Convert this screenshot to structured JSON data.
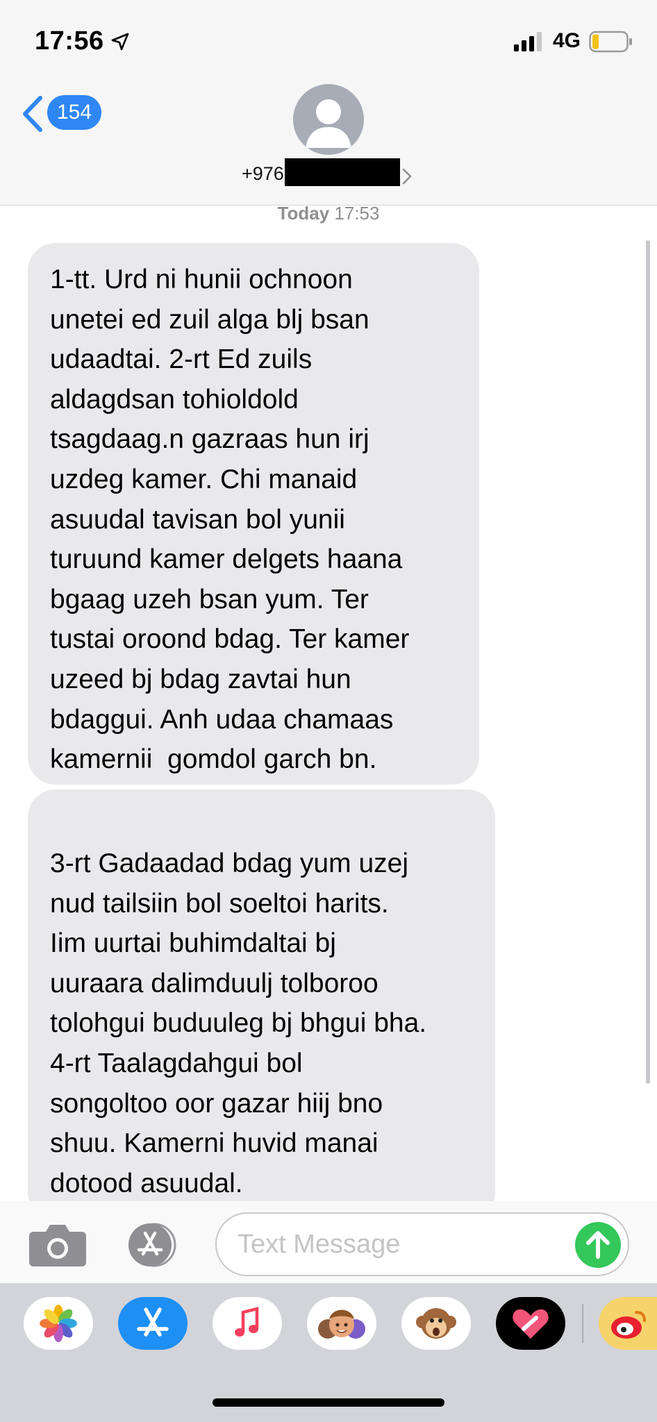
{
  "status_bar": {
    "time": "17:56",
    "network": "4G",
    "icons": [
      "location-arrow-icon",
      "signal-bars-icon",
      "battery-low-icon"
    ]
  },
  "header": {
    "back_count": "154",
    "contact_number_visible": "+976",
    "contact_number_redacted": true
  },
  "conversation": {
    "timestamp_day": "Today",
    "timestamp_time": "17:53",
    "messages": [
      {
        "direction": "incoming",
        "lines": [
          "1-tt. Urd ni hunii ochnoon",
          "unetei ed zuil alga blj bsan",
          "udaadtai. 2-rt Ed zuils",
          "aldagdsan tohioldold",
          "tsagdaag.n gazraas hun irj",
          "uzdeg kamer. Chi manaid",
          "asuudal tavisan bol yunii",
          "turuund kamer delgets haana",
          "bgaag uzeh bsan yum. Ter",
          "tustai oroond bdag. Ter kamer",
          "uzeed bj bdag zavtai hun",
          "bdaggui. Anh udaa chamaas",
          "kamernii  gomdol garch bn."
        ]
      },
      {
        "direction": "incoming",
        "lines": [
          "3-rt Gadaadad bdag yum uzej",
          "nud tailsiin bol soeltoi harits.",
          "Iim uurtai buhimdaltai bj",
          "uuraara dalimduulj tolboroo",
          "tolohgui buduuleg bj bhgui bha.",
          "4-rt Taalagdahgui bol",
          "songoltoo oor gazar hiij bno",
          "shuu. Kamerni huvid manai",
          "dotood asuudal."
        ]
      }
    ]
  },
  "composer": {
    "placeholder": "Text Message",
    "value": "",
    "icons": [
      "camera-icon",
      "app-store-icon",
      "send-arrow-icon"
    ]
  },
  "app_drawer": {
    "apps": [
      "photos-app-icon",
      "app-store-app-icon",
      "music-app-icon",
      "memoji-app-icon",
      "animoji-app-icon",
      "digital-touch-app-icon",
      "weibo-app-icon"
    ],
    "accent_colors": {
      "send": "#34c759",
      "badge": "#2f87f5",
      "bubble": "#e9e9eb"
    }
  }
}
